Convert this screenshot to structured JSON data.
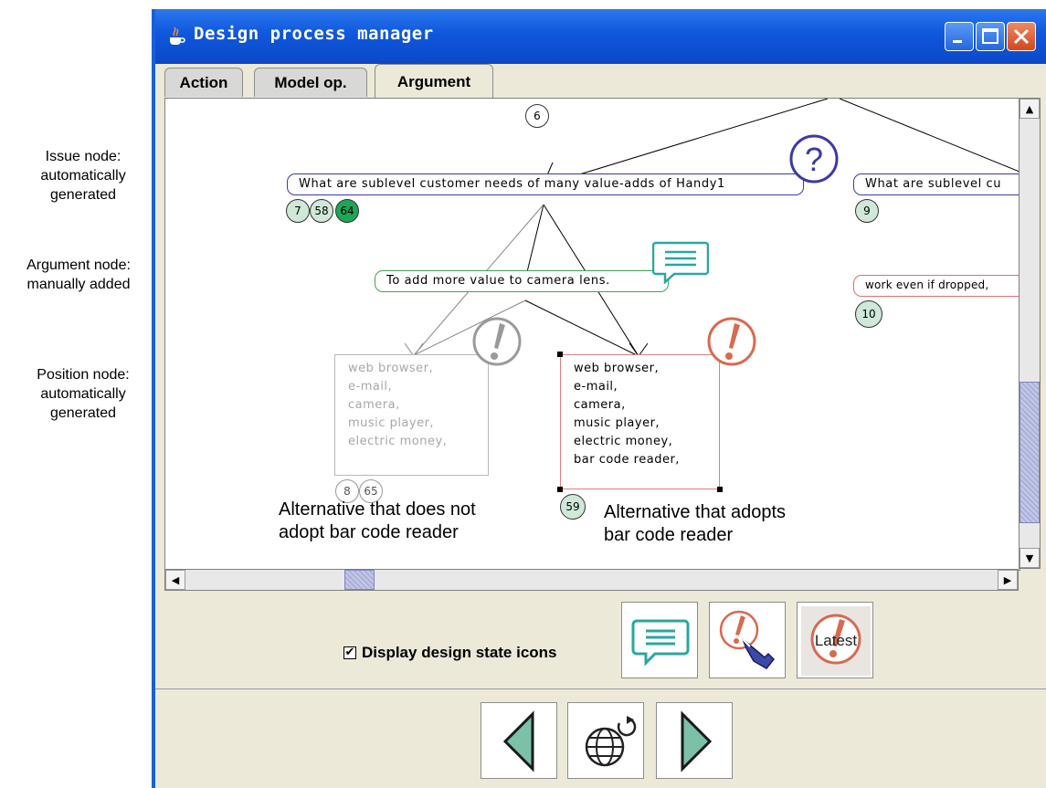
{
  "annotations": [
    {
      "lines": [
        "Issue node:",
        "automatically",
        "generated"
      ]
    },
    {
      "lines": [
        "Argument node:",
        "manually added"
      ]
    },
    {
      "lines": [
        "Position node:",
        "automatically",
        "generated"
      ]
    }
  ],
  "window": {
    "title": "Design process manager",
    "tabs": [
      {
        "label": "Action",
        "active": false
      },
      {
        "label": "Model op.",
        "active": false
      },
      {
        "label": "Argument",
        "active": true
      }
    ]
  },
  "graph": {
    "top_badge": "6",
    "issue_node": {
      "text": "What are sublevel customer needs of many value-adds of Handy1",
      "badges": [
        "7",
        "58",
        "64"
      ]
    },
    "issue_node_right": {
      "text": "What are sublevel cu",
      "badge": "9"
    },
    "argument_node": {
      "text": "To add more value to camera lens."
    },
    "argument_node_right": {
      "text": "work even if dropped,",
      "badge": "10"
    },
    "position_left": {
      "items": [
        "web browser,",
        "e-mail,",
        "camera,",
        "music player,",
        "electric money,"
      ],
      "badges": [
        "8",
        "65"
      ]
    },
    "position_right": {
      "items": [
        "web browser,",
        "e-mail,",
        "camera,",
        "music player,",
        "electric money,",
        "bar code reader,"
      ],
      "badge": "59"
    },
    "caption_left": [
      "Alternative that does not",
      "adopt bar code reader"
    ],
    "caption_right": [
      "Alternative that adopts",
      "bar code reader"
    ]
  },
  "toolbar": {
    "checkbox_label": "Display design state icons",
    "checkbox_checked": true,
    "latest_label": "Latest"
  },
  "colors": {
    "issue_blue": "#3a3aa8",
    "argument_green": "#2aa7a0",
    "position_red": "#d86a50",
    "badge_dark_green": "#1ca655",
    "title_bar_blue": "#0a49c8"
  }
}
